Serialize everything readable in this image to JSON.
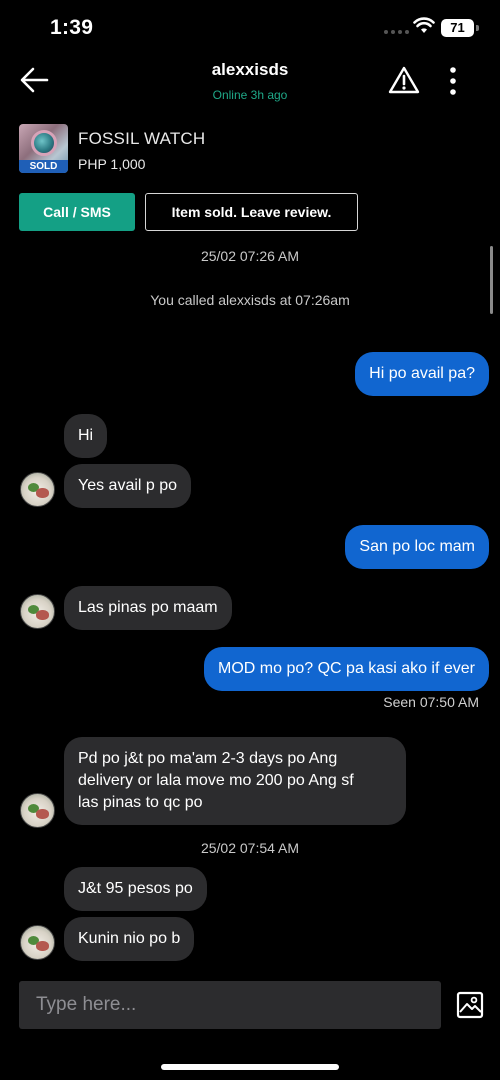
{
  "status_bar": {
    "time": "1:39",
    "battery": "71"
  },
  "header": {
    "name": "alexxisds",
    "online": "Online 3h ago"
  },
  "listing": {
    "title": "FOSSIL WATCH",
    "price": "PHP 1,000",
    "tag": "SOLD"
  },
  "actions": {
    "call": "Call / SMS",
    "review": "Item sold. Leave review."
  },
  "colors": {
    "accent_green": "#14a085",
    "outgoing_bubble": "#1166d0",
    "incoming_bubble": "#2c2c2e",
    "online_text": "#1fa888"
  },
  "chat": {
    "timestamp1": "25/02 07:26 AM",
    "system_call": "You called alexxisds at 07:26am",
    "m1": "Hi po avail pa?",
    "m2": "Hi",
    "m3": "Yes avail p po",
    "m4": "San po loc mam",
    "m5": "Las pinas po maam",
    "m6": "MOD mo po? QC pa kasi ako if ever",
    "seen": "Seen 07:50 AM",
    "m7_line1": "Pd po j&t po ma'am 2-3 days po Ang",
    "m7_line2": "delivery or lala move mo 200 po Ang sf",
    "m7_line3": "las pinas to qc po",
    "timestamp2": "25/02 07:54 AM",
    "m8": "J&t 95 pesos po",
    "m9": "Kunin nio po b"
  },
  "composer": {
    "placeholder": "Type here..."
  },
  "icons": {
    "back": "arrow-left-icon",
    "report": "warning-triangle-icon",
    "more": "vertical-dots-icon",
    "attach": "image-attach-icon",
    "wifi": "wifi-icon"
  }
}
